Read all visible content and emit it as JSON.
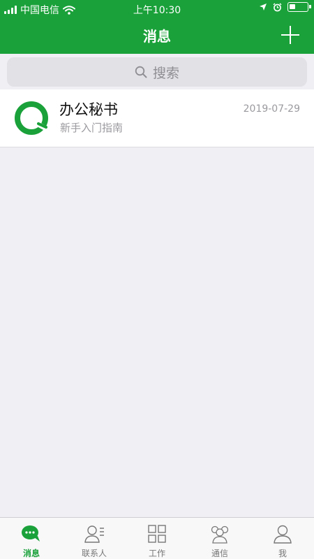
{
  "status_bar": {
    "carrier": "中国电信",
    "time": "上午10:30",
    "battery_level": 0.35
  },
  "header": {
    "title": "消息",
    "add_icon": "plus-icon"
  },
  "search": {
    "placeholder": "搜索",
    "icon": "search-icon"
  },
  "messages": [
    {
      "title": "办公秘书",
      "subtitle": "新手入门指南",
      "date": "2019-07-29",
      "avatar_icon": "q-logo-icon"
    }
  ],
  "tabs": [
    {
      "label": "消息",
      "icon": "chat-bubble-icon",
      "active": true
    },
    {
      "label": "联系人",
      "icon": "contacts-icon",
      "active": false
    },
    {
      "label": "工作",
      "icon": "grid-icon",
      "active": false
    },
    {
      "label": "通信",
      "icon": "group-icon",
      "active": false
    },
    {
      "label": "我",
      "icon": "person-icon",
      "active": false
    }
  ],
  "colors": {
    "brand_green": "#1aa13a",
    "background": "#efeff4",
    "secondary_text": "#9a9a9f"
  }
}
